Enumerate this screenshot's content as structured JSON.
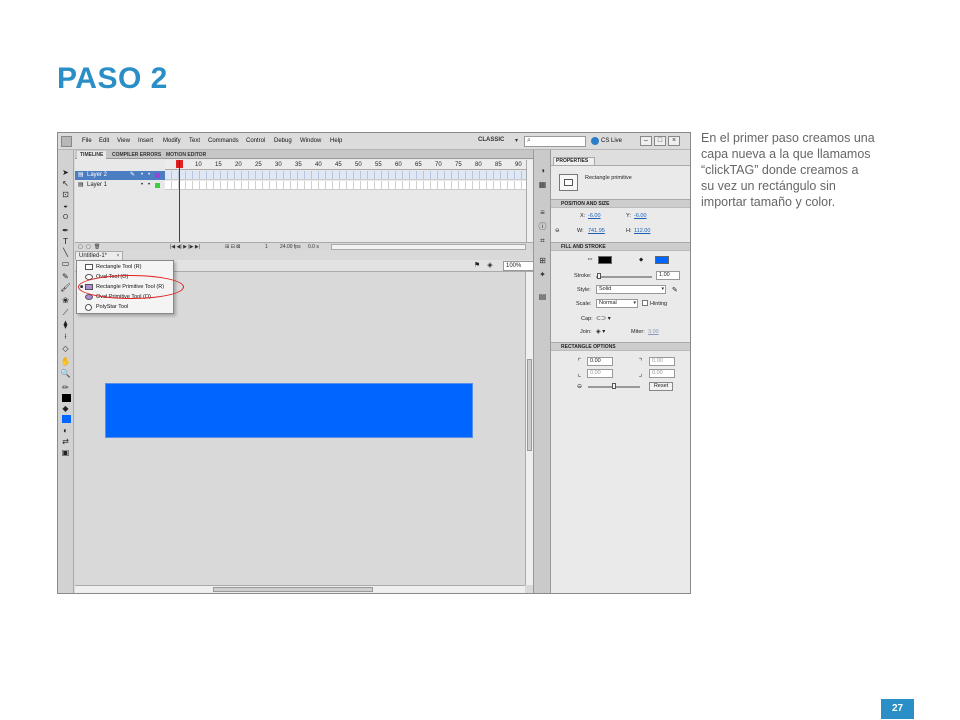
{
  "slide": {
    "title": "PASO 2",
    "note_lines": [
      "En el primer paso creamos una",
      "capa nueva a la que llamamos",
      "“clickTAG” donde  creamos a",
      "su vez un rectángulo sin",
      "importar tamaño y color."
    ],
    "page_number": "27",
    "accent_color": "#2a8fc6"
  },
  "app": {
    "menu": [
      "File",
      "Edit",
      "View",
      "Insert",
      "Modify",
      "Text",
      "Commands",
      "Control",
      "Debug",
      "Window",
      "Help"
    ],
    "workspace": "CLASSIC",
    "cs_live": "CS Live",
    "window_buttons": [
      "–",
      "□",
      "×"
    ]
  },
  "timeline": {
    "tabs": [
      "TIMELINE",
      "COMPILER ERRORS",
      "MOTION EDITOR"
    ],
    "frame_numbers": [
      "5",
      "10",
      "15",
      "20",
      "25",
      "30",
      "35",
      "40",
      "45",
      "50",
      "55",
      "60",
      "65",
      "70",
      "75",
      "80",
      "85",
      "90"
    ],
    "layers": [
      {
        "name": "Layer 2",
        "selected": true
      },
      {
        "name": "Layer 1",
        "selected": false
      }
    ],
    "current_frame": "1",
    "fps": "24.00 fps",
    "time": "0.0 s"
  },
  "document": {
    "tab": "Untitled-1*",
    "zoom": "100%"
  },
  "stage": {
    "rectangle_color": "#0066ff"
  },
  "flyout": {
    "items": [
      {
        "label": "Rectangle Tool (R)",
        "icon": "rectangle-icon",
        "selected": false
      },
      {
        "label": "Oval Tool (O)",
        "icon": "oval-icon",
        "selected": false
      },
      {
        "label": "Rectangle Primitive Tool (R)",
        "icon": "rectangle-primitive-icon",
        "selected": true
      },
      {
        "label": "Oval Primitive Tool (O)",
        "icon": "oval-primitive-icon",
        "selected": false
      },
      {
        "label": "PolyStar Tool",
        "icon": "polystar-icon",
        "selected": false
      }
    ],
    "highlight_color": "#e11f1f"
  },
  "properties": {
    "tab": "PROPERTIES",
    "instance_type": "Rectangle primitive",
    "position_size": {
      "header": "POSITION AND SIZE",
      "x_label": "X:",
      "x": "-6.00",
      "y_label": "Y:",
      "y": "-6.00",
      "w_label": "W:",
      "w": "741.95",
      "h_label": "H:",
      "h": "112.00"
    },
    "fill_stroke": {
      "header": "FILL AND STROKE",
      "stroke_color": "#000000",
      "fill_color": "#0066ff",
      "stroke_label": "Stroke:",
      "stroke": "1.00",
      "style_label": "Style:",
      "style": "Solid",
      "scale_label": "Scale:",
      "scale": "Normal",
      "hinting_label": "Hinting",
      "cap_label": "Cap:",
      "join_label": "Join:",
      "miter_label": "Miter:",
      "miter": "3.00"
    },
    "rectangle_options": {
      "header": "RECTANGLE OPTIONS",
      "corners": [
        "0.00",
        "0.00",
        "0.00",
        "0.00"
      ],
      "reset": "Reset"
    }
  }
}
